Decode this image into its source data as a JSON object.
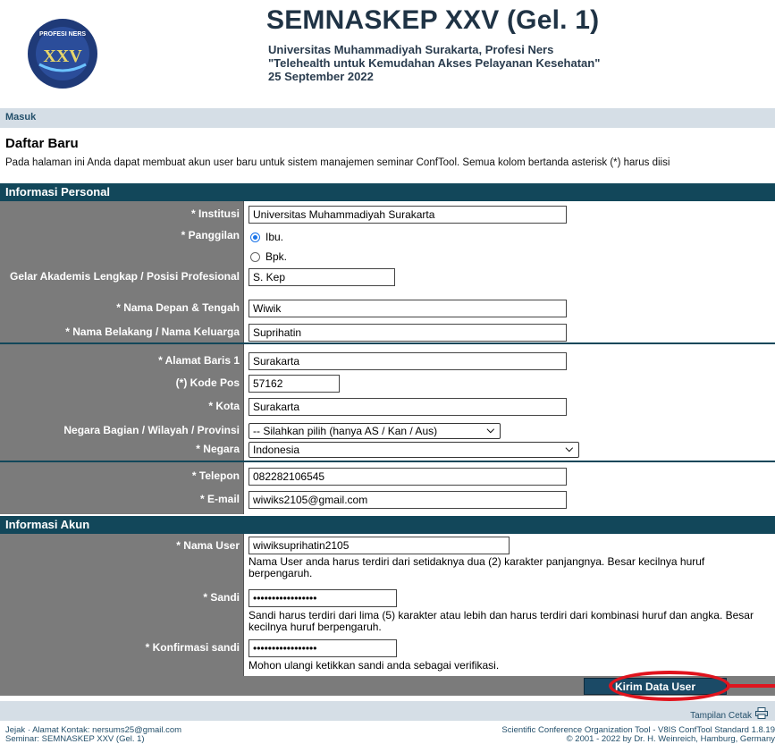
{
  "header": {
    "logo_text": "PROFESI NERS XXV",
    "title": "SEMNASKEP XXV (Gel. 1)",
    "subtitle1": "Universitas Muhammadiyah Surakarta, Profesi Ners",
    "subtitle2": "\"Telehealth untuk Kemudahan Akses Pelayanan Kesehatan\"",
    "date": "25 September 2022"
  },
  "nav": {
    "login": "Masuk"
  },
  "page": {
    "title": "Daftar Baru",
    "intro": "Pada halaman ini Anda dapat membuat akun user baru untuk sistem manajemen seminar ConfTool. Semua kolom bertanda asterisk (*) harus diisi"
  },
  "personal": {
    "heading": "Informasi Personal",
    "institution_label": "* Institusi",
    "institution_value": "Universitas Muhammadiyah Surakarta",
    "salutation_label": "* Panggilan",
    "salutation_options": [
      "Ibu.",
      "Bpk."
    ],
    "salutation_selected": "Ibu.",
    "degree_label": "Gelar Akademis Lengkap / Posisi Profesional",
    "degree_value": "S. Kep",
    "firstname_label": "* Nama Depan & Tengah",
    "firstname_value": "Wiwik",
    "lastname_label": "* Nama Belakang / Nama Keluarga",
    "lastname_value": "Suprihatin",
    "address_label": "* Alamat Baris 1",
    "address_value": "Surakarta",
    "postcode_label": "(*) Kode Pos",
    "postcode_value": "57162",
    "city_label": "* Kota",
    "city_value": "Surakarta",
    "state_label": "Negara Bagian / Wilayah / Provinsi",
    "state_value": "-- Silahkan pilih (hanya AS / Kan / Aus)",
    "country_label": "* Negara",
    "country_value": "Indonesia",
    "phone_label": "* Telepon",
    "phone_value": "082282106545",
    "email_label": "* E-mail",
    "email_value": "wiwiks2105@gmail.com"
  },
  "account": {
    "heading": "Informasi Akun",
    "username_label": "* Nama User",
    "username_value": "wiwiksuprihatin2105",
    "username_hint": "Nama User anda harus terdiri dari setidaknya dua (2) karakter panjangnya. Besar kecilnya huruf berpengaruh.",
    "password_label": "* Sandi",
    "password_value": "•••••••••••••••••",
    "password_hint": "Sandi harus terdiri dari lima (5) karakter atau lebih dan harus terdiri dari kombinasi huruf dan angka. Besar kecilnya huruf berpengaruh.",
    "confirm_label": "* Konfirmasi sandi",
    "confirm_value": "•••••••••••••••••",
    "confirm_hint": "Mohon ulangi ketikkan sandi anda sebagai verifikasi."
  },
  "submit_label": "Kirim Data User",
  "print_label": "Tampilan Cetak",
  "footer": {
    "left1": "Jejak · Alamat Kontak: nersums25@gmail.com",
    "left2": "Seminar: SEMNASKEP XXV (Gel. 1)",
    "right1": "Scientific Conference Organization Tool - V8IS ConfTool Standard 1.8.19",
    "right2": "© 2001 - 2022 by Dr. H. Weinreich, Hamburg, Germany"
  },
  "colors": {
    "section": "#12475a",
    "label_bg": "#7b7b7b",
    "nav_bg": "#d5dee6",
    "highlight": "#e0141e"
  }
}
